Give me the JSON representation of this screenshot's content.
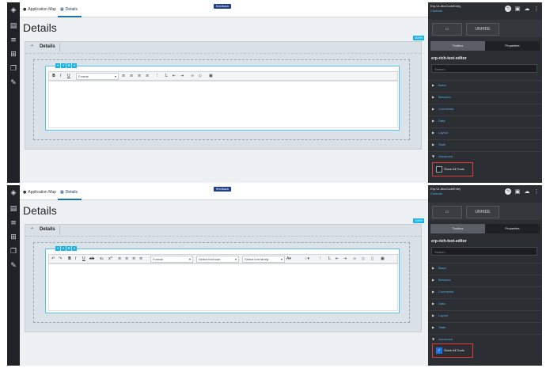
{
  "tabs": {
    "app_map": "Application Map",
    "details": "Details"
  },
  "feedback_label": "feedback",
  "page_title": "Details",
  "zoom_badge": "100%",
  "section_label": "Details",
  "right_panel": {
    "title": "Erp.UI.AbcCodeEntry",
    "subtitle": "Controls",
    "unhide_label": "UNHIDE",
    "tabs": {
      "toolbox": "Toolbox",
      "properties": "Properties"
    },
    "heading": "erp-rich-text-editor",
    "search_placeholder": "Search...",
    "categories": [
      "Basic",
      "Behavior",
      "Comments",
      "Data",
      "Layout",
      "State",
      "Advanced"
    ],
    "show_all_tools_label": "Show All Tools"
  },
  "screen_a": {
    "show_all_tools_checked": false
  },
  "screen_b": {
    "show_all_tools_checked": true
  },
  "editor_basic": {
    "format_select": "Format"
  },
  "editor_full": {
    "format_select": "Format",
    "font_size_select": "Select font size",
    "font_family_select": "Select font family"
  },
  "colors": {
    "accent": "#1ab3e6",
    "feedback_bg": "#1e3f88",
    "highlight_border": "#e53935",
    "link_blue": "#56b4e9",
    "checkbox_on": "#1a73e8"
  }
}
